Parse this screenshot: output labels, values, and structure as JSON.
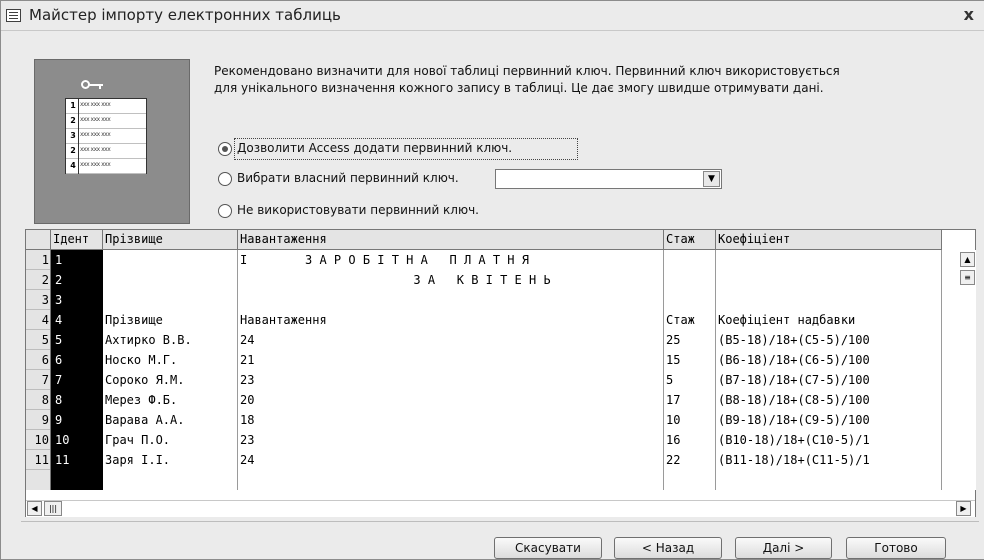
{
  "window": {
    "title": "Майстер імпорту електронних таблиць",
    "close_glyph": "x"
  },
  "intro": {
    "text": "Рекомендовано визначити для нової таблиці первинний ключ. Первинний ключ використовується для унікального визначення кожного запису в таблиці. Це дає змогу швидше отримувати дані."
  },
  "icon_panel": {
    "rows": [
      "1",
      "2",
      "3",
      "2",
      "4"
    ],
    "cells": "xxx xxx xxx"
  },
  "options": [
    {
      "label": "Дозволити Access додати первинний ключ.",
      "selected": true
    },
    {
      "label": "Вибрати власний первинний ключ.",
      "selected": false
    },
    {
      "label": "Не використовувати первинний ключ.",
      "selected": false
    }
  ],
  "key_select": {
    "value": ""
  },
  "grid": {
    "columns": [
      "Ідент",
      "Прізвище",
      "Навантаження",
      "Стаж",
      "Коефіціент"
    ],
    "row_numbers": [
      "1",
      "2",
      "3",
      "4",
      "5",
      "6",
      "7",
      "8",
      "9",
      "10",
      "11"
    ],
    "rows": [
      [
        "1",
        "",
        "І        З А Р О Б І Т Н А   П Л А Т Н Я",
        "",
        ""
      ],
      [
        "2",
        "",
        "                        З А   К В І Т Е Н Ь",
        "",
        ""
      ],
      [
        "3",
        "",
        "",
        "",
        ""
      ],
      [
        "4",
        "Прізвище",
        "Навантаження",
        "Стаж",
        "Коефіціент надбавки"
      ],
      [
        "5",
        "Ахтирко В.В.",
        "24",
        "25",
        "(B5-18)/18+(C5-5)/100"
      ],
      [
        "6",
        "Носко М.Г.",
        "21",
        "15",
        "(B6-18)/18+(C6-5)/100"
      ],
      [
        "7",
        "Сороко Я.М.",
        "23",
        "5",
        "(B7-18)/18+(C7-5)/100"
      ],
      [
        "8",
        "Мерез Ф.Б.",
        "20",
        "17",
        "(B8-18)/18+(C8-5)/100"
      ],
      [
        "9",
        "Варава А.А.",
        "18",
        "10",
        "(B9-18)/18+(C9-5)/100"
      ],
      [
        "10",
        "Грач П.О.",
        "23",
        "16",
        "(B10-18)/18+(C10-5)/1"
      ],
      [
        "11",
        "Заря І.І.",
        "24",
        "22",
        "(B11-18)/18+(C11-5)/1"
      ]
    ]
  },
  "buttons": {
    "cancel": "Скасувати",
    "back": "< Назад",
    "next": "Далі >",
    "finish": "Готово"
  }
}
